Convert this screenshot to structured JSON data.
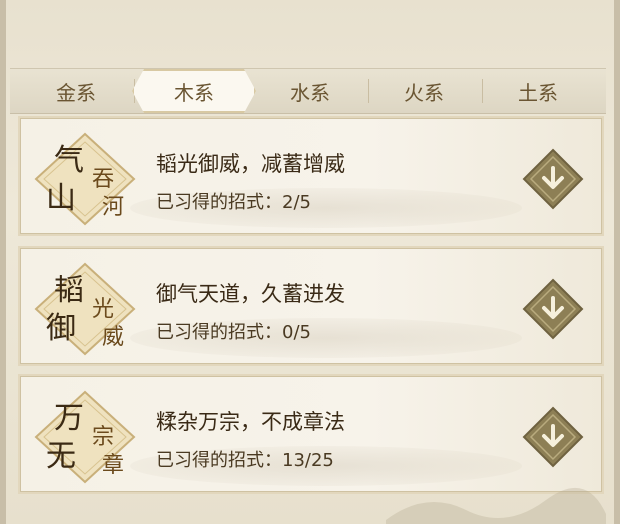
{
  "tabs": [
    {
      "label": "金系",
      "active": false
    },
    {
      "label": "木系",
      "active": true
    },
    {
      "label": "水系",
      "active": false
    },
    {
      "label": "火系",
      "active": false
    },
    {
      "label": "土系",
      "active": false
    }
  ],
  "skills": [
    {
      "emblem_main": [
        "气",
        "山"
      ],
      "emblem_sub": [
        "吞",
        "河"
      ],
      "title": "韬光御威，减蓄增威",
      "progress_label": "已习得的招式：",
      "progress": "2/5"
    },
    {
      "emblem_main": [
        "韬",
        "御"
      ],
      "emblem_sub": [
        "光",
        "威"
      ],
      "title": "御气天道，久蓄进发",
      "progress_label": "已习得的招式：",
      "progress": "0/5"
    },
    {
      "emblem_main": [
        "万",
        "无"
      ],
      "emblem_sub": [
        "宗",
        "章"
      ],
      "title": "糅杂万宗，不成章法",
      "progress_label": "已习得的招式：",
      "progress": "13/25"
    }
  ],
  "icons": {
    "expand": "chevron-down-icon"
  },
  "colors": {
    "accent": "#8a7a50",
    "text": "#3a2a16",
    "emblem_bg": "#efe2bf"
  }
}
